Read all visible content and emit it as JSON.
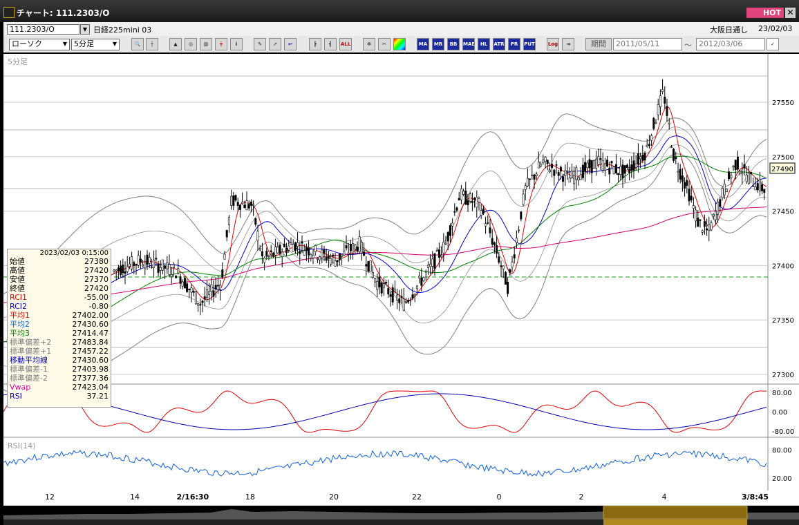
{
  "window": {
    "title": "チャート: 111.2303/O",
    "hot": "HOT",
    "close": "✕"
  },
  "toolbar1": {
    "symbol_value": "111.2303/O",
    "symbol_name": "日経225mini 03",
    "session": "大阪日通し",
    "date": "23/02/03"
  },
  "toolbar2": {
    "chart_type": "ローソク",
    "interval": "5分足",
    "period_button": "期間",
    "date_from": "2011/05/11",
    "date_to": "2012/03/06",
    "date_sep": "〜",
    "buttons": [
      "zoom",
      "cross",
      "chart",
      "chart2",
      "candle",
      "info",
      "pencil",
      "select",
      "arrow",
      "bar1",
      "bar2",
      "ALL",
      "gear",
      "tool",
      "palette",
      "MA",
      "MR",
      "BB",
      "MAE",
      "HL",
      "ATR",
      "PR",
      "PUT",
      "Log",
      "exit"
    ]
  },
  "chart": {
    "period_label": "5分足",
    "price_labels": [
      "27550",
      "27500",
      "27450",
      "27400",
      "27350",
      "27300"
    ],
    "current_price": "27490",
    "rci_labels": [
      "80.00",
      "0.00",
      "-80.00"
    ],
    "rsi_title": "RSI(14)",
    "rsi_labels": [
      "80.00",
      "20.00"
    ],
    "x_labels": [
      "12",
      "14",
      "2/16:30",
      "18",
      "20",
      "22",
      "0",
      "2",
      "4",
      "3/8:45"
    ]
  },
  "ohlc_panel": {
    "datetime": "2023/02/03  0:15:00",
    "rows": [
      {
        "label": "始値",
        "value": "27380",
        "color": "#000000"
      },
      {
        "label": "高値",
        "value": "27420",
        "color": "#000000"
      },
      {
        "label": "安値",
        "value": "27370",
        "color": "#000000"
      },
      {
        "label": "終値",
        "value": "27420",
        "color": "#000000"
      },
      {
        "label": "RCI1",
        "value": "-55.00",
        "color": "#e00000"
      },
      {
        "label": "RCI2",
        "value": "-0.80",
        "color": "#0000c0"
      },
      {
        "label": "平均1",
        "value": "27402.00",
        "color": "#e00000"
      },
      {
        "label": "平均2",
        "value": "27430.60",
        "color": "#0060e0"
      },
      {
        "label": "平均3",
        "value": "27414.47",
        "color": "#008000"
      },
      {
        "label": "標準偏差+2",
        "value": "27483.84",
        "color": "#808080"
      },
      {
        "label": "標準偏差+1",
        "value": "27457.22",
        "color": "#808080"
      },
      {
        "label": "移動平均線",
        "value": "27430.60",
        "color": "#0000c0"
      },
      {
        "label": "標準偏差-1",
        "value": "27403.98",
        "color": "#808080"
      },
      {
        "label": "標準偏差-2",
        "value": "27377.36",
        "color": "#808080"
      },
      {
        "label": "Vwap",
        "value": "27423.04",
        "color": "#e000a0"
      },
      {
        "label": "RSI",
        "value": "37.21",
        "color": "#0000c0"
      }
    ]
  },
  "colors": {
    "ma1": "#e00000",
    "ma2": "#0000d0",
    "ma3": "#008000",
    "vwap": "#d0006a",
    "bb": "#808080",
    "rsi": "#1060e0",
    "dashed": "#00a000"
  }
}
